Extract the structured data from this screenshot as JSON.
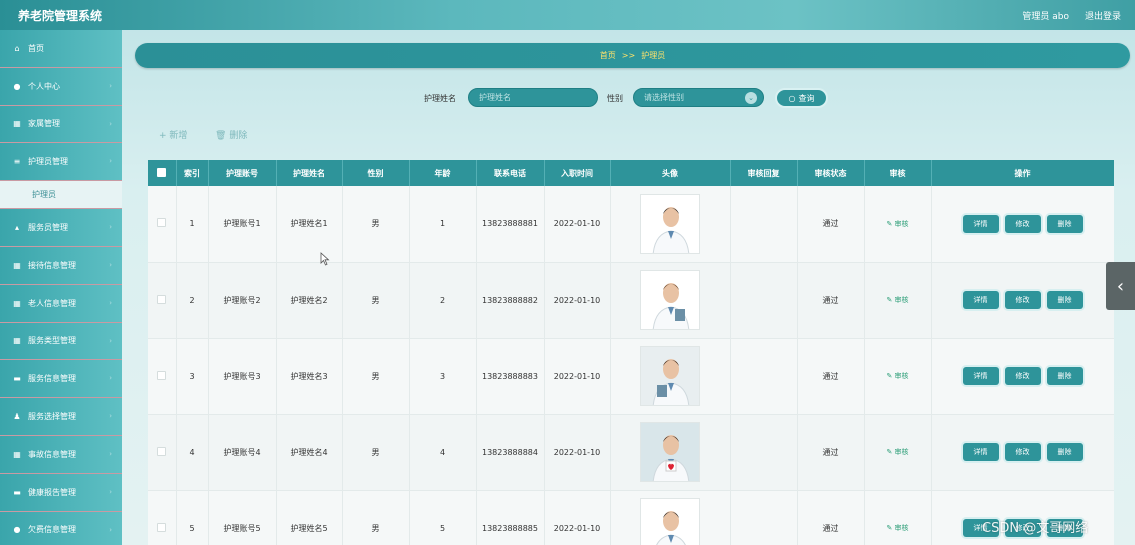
{
  "header": {
    "title": "养老院管理系统",
    "user": "管理员 abo",
    "logout": "退出登录"
  },
  "sidebar": {
    "items": [
      {
        "label": "首页",
        "icon": "home-icon",
        "glyph": "⌂"
      },
      {
        "label": "个人中心",
        "icon": "user-icon",
        "glyph": "●"
      },
      {
        "label": "家属管理",
        "icon": "grid-icon",
        "glyph": "▦"
      },
      {
        "label": "护理员管理",
        "icon": "list-icon",
        "glyph": "≡"
      },
      {
        "label": "服务员管理",
        "icon": "thumb-icon",
        "glyph": "▴"
      },
      {
        "label": "接待信息管理",
        "icon": "grid-icon",
        "glyph": "▦"
      },
      {
        "label": "老人信息管理",
        "icon": "grid-icon",
        "glyph": "▦"
      },
      {
        "label": "服务类型管理",
        "icon": "grid-icon",
        "glyph": "▦"
      },
      {
        "label": "服务信息管理",
        "icon": "monitor-icon",
        "glyph": "▬"
      },
      {
        "label": "服务选择管理",
        "icon": "person-icon",
        "glyph": "♟"
      },
      {
        "label": "事故信息管理",
        "icon": "grid-icon",
        "glyph": "▦"
      },
      {
        "label": "健康报告管理",
        "icon": "doc-icon",
        "glyph": "▬"
      },
      {
        "label": "欠费信息管理",
        "icon": "pin-icon",
        "glyph": "●"
      }
    ],
    "sub_item": "护理员"
  },
  "breadcrumb": {
    "home": "首页",
    "sep": ">>",
    "current": "护理员"
  },
  "search": {
    "name_label": "护理姓名",
    "name_placeholder": "护理姓名",
    "gender_label": "性别",
    "gender_placeholder": "请选择性别",
    "query_button": "查询"
  },
  "toolbar": {
    "add": "+ 新增",
    "delete": "删除"
  },
  "table": {
    "headers": [
      "索引",
      "护理账号",
      "护理姓名",
      "性别",
      "年龄",
      "联系电话",
      "入职时间",
      "头像",
      "审核回复",
      "审核状态",
      "审核",
      "操作"
    ],
    "rows": [
      {
        "index": "1",
        "account": "护理账号1",
        "name": "护理姓名1",
        "gender": "男",
        "age": "1",
        "phone": "13823888881",
        "date": "2022-01-10",
        "reply": "",
        "status": "通过"
      },
      {
        "index": "2",
        "account": "护理账号2",
        "name": "护理姓名2",
        "gender": "男",
        "age": "2",
        "phone": "13823888882",
        "date": "2022-01-10",
        "reply": "",
        "status": "通过"
      },
      {
        "index": "3",
        "account": "护理账号3",
        "name": "护理姓名3",
        "gender": "男",
        "age": "3",
        "phone": "13823888883",
        "date": "2022-01-10",
        "reply": "",
        "status": "通过"
      },
      {
        "index": "4",
        "account": "护理账号4",
        "name": "护理姓名4",
        "gender": "男",
        "age": "4",
        "phone": "13823888884",
        "date": "2022-01-10",
        "reply": "",
        "status": "通过"
      },
      {
        "index": "5",
        "account": "护理账号5",
        "name": "护理姓名5",
        "gender": "男",
        "age": "5",
        "phone": "13823888885",
        "date": "2022-01-10",
        "reply": "",
        "status": "通过"
      }
    ],
    "audit_link": "审核",
    "btn_detail": "详情",
    "btn_edit": "修改",
    "btn_delete": "删除"
  },
  "watermark": "CSDN @文哥网络",
  "colors": {
    "primary": "#2e949a",
    "accent": "#ffe36b",
    "success": "#2a9d76"
  }
}
